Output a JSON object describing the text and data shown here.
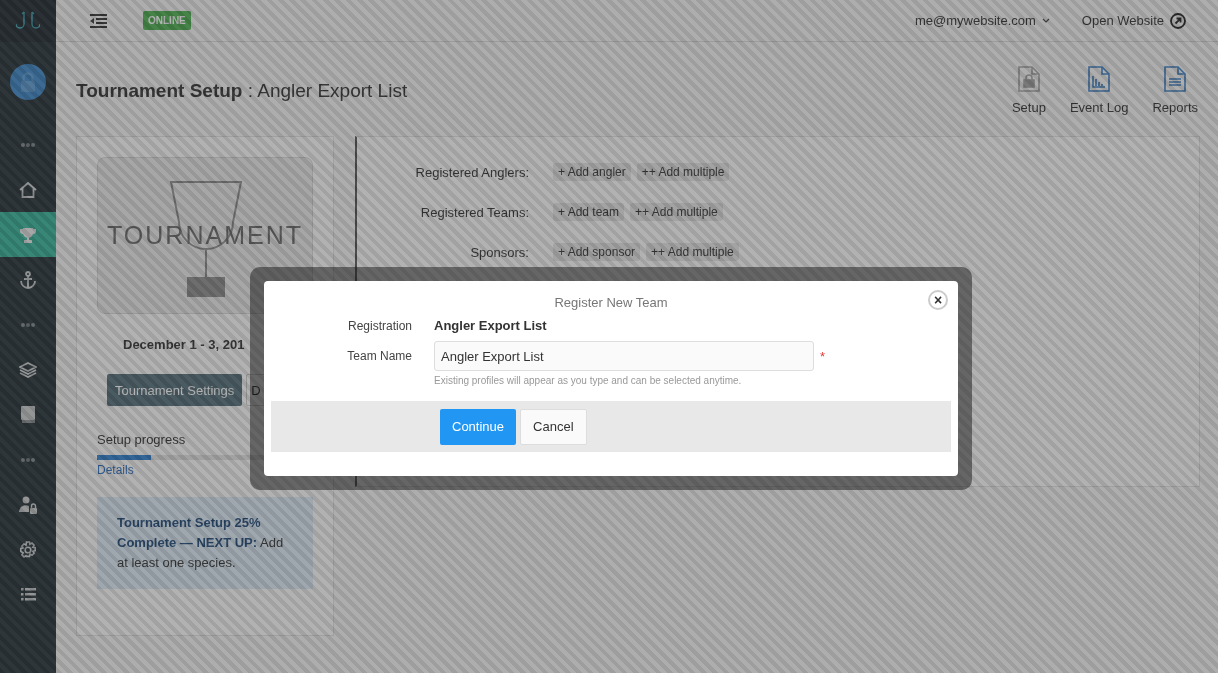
{
  "sidebar": {
    "items": [
      {
        "kind": "logo",
        "selected": false
      },
      {
        "kind": "avatar",
        "selected": false
      },
      {
        "kind": "dots",
        "selected": false
      },
      {
        "kind": "home",
        "selected": false
      },
      {
        "kind": "trophy",
        "selected": true
      },
      {
        "kind": "anchor",
        "selected": false
      },
      {
        "kind": "dots",
        "selected": false
      },
      {
        "kind": "layers",
        "selected": false
      },
      {
        "kind": "book",
        "selected": false
      },
      {
        "kind": "dots",
        "selected": false
      },
      {
        "kind": "user-lock",
        "selected": false
      },
      {
        "kind": "gear",
        "selected": false
      },
      {
        "kind": "list",
        "selected": false
      }
    ]
  },
  "header": {
    "status_badge": "ONLINE",
    "account": "me@mywebsite.com",
    "open_website": "Open Website"
  },
  "page_title": "**Tournament Setup** : Angler Export List",
  "toolbar": [
    {
      "label": "Setup",
      "kind": "lock",
      "disabled": true
    },
    {
      "label": "Event Log",
      "kind": "chart",
      "disabled": false
    },
    {
      "label": "Reports",
      "kind": "lines",
      "disabled": false
    }
  ],
  "tournament_card": {
    "cover_caption": "TOURNAMENT",
    "dates": "December 1 - 3, 201",
    "buttons": [
      {
        "label": "Tournament Settings",
        "kind": "primary"
      },
      {
        "label": "D",
        "kind": "default"
      }
    ],
    "progress_label": "Setup progress",
    "progress": {
      "level": 0.25
    },
    "details_link": "Details",
    "notice": "**Tournament Setup 25% Complete — NEXT UP:** Add at least one species."
  },
  "registration_rows": [
    {
      "label": "Registered Anglers:",
      "actions": [
        "+ Add angler",
        "++ Add multiple"
      ]
    },
    {
      "label": "Registered Teams:",
      "actions": [
        "+ Add team",
        "++ Add multiple"
      ]
    },
    {
      "label": "Sponsors:",
      "actions": [
        "+ Add sponsor",
        "++ Add multiple"
      ]
    }
  ],
  "dialog": {
    "title": "Register New Team",
    "close": "×",
    "registration_label": "Registration",
    "registration_value": "Angler Export List",
    "team_name_label": "Team Name",
    "team_name_value": "Angler Export List",
    "required_mark": "*",
    "hint": "Existing profiles will appear as you type and can be selected anytime.",
    "buttons": [
      {
        "label": "Continue",
        "kind": "primary"
      },
      {
        "label": "Cancel",
        "kind": "default"
      }
    ]
  }
}
